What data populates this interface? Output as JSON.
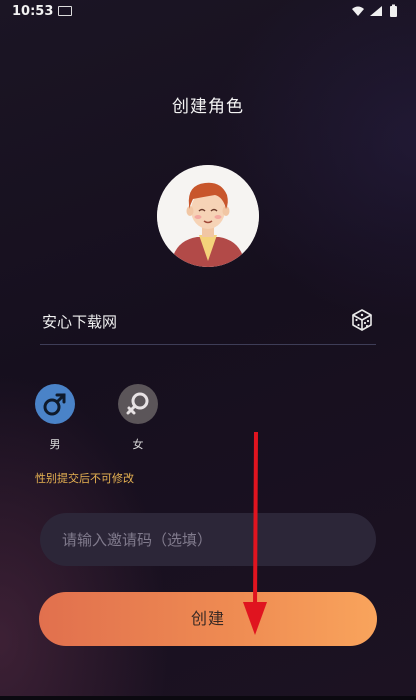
{
  "status": {
    "time": "10:53"
  },
  "title": "创建角色",
  "name": {
    "value": "安心下载网"
  },
  "gender": [
    {
      "label": "男",
      "symbol": "♂"
    },
    {
      "label": "女",
      "symbol": "♀"
    }
  ],
  "hint": "性别提交后不可修改",
  "invite": {
    "placeholder": "请输入邀请码（选填）"
  },
  "create_label": "创建",
  "colors": {
    "accent": "#ee8a52",
    "male": "#4a83c8",
    "hint": "#e8b352",
    "arrow": "#e0141f"
  }
}
